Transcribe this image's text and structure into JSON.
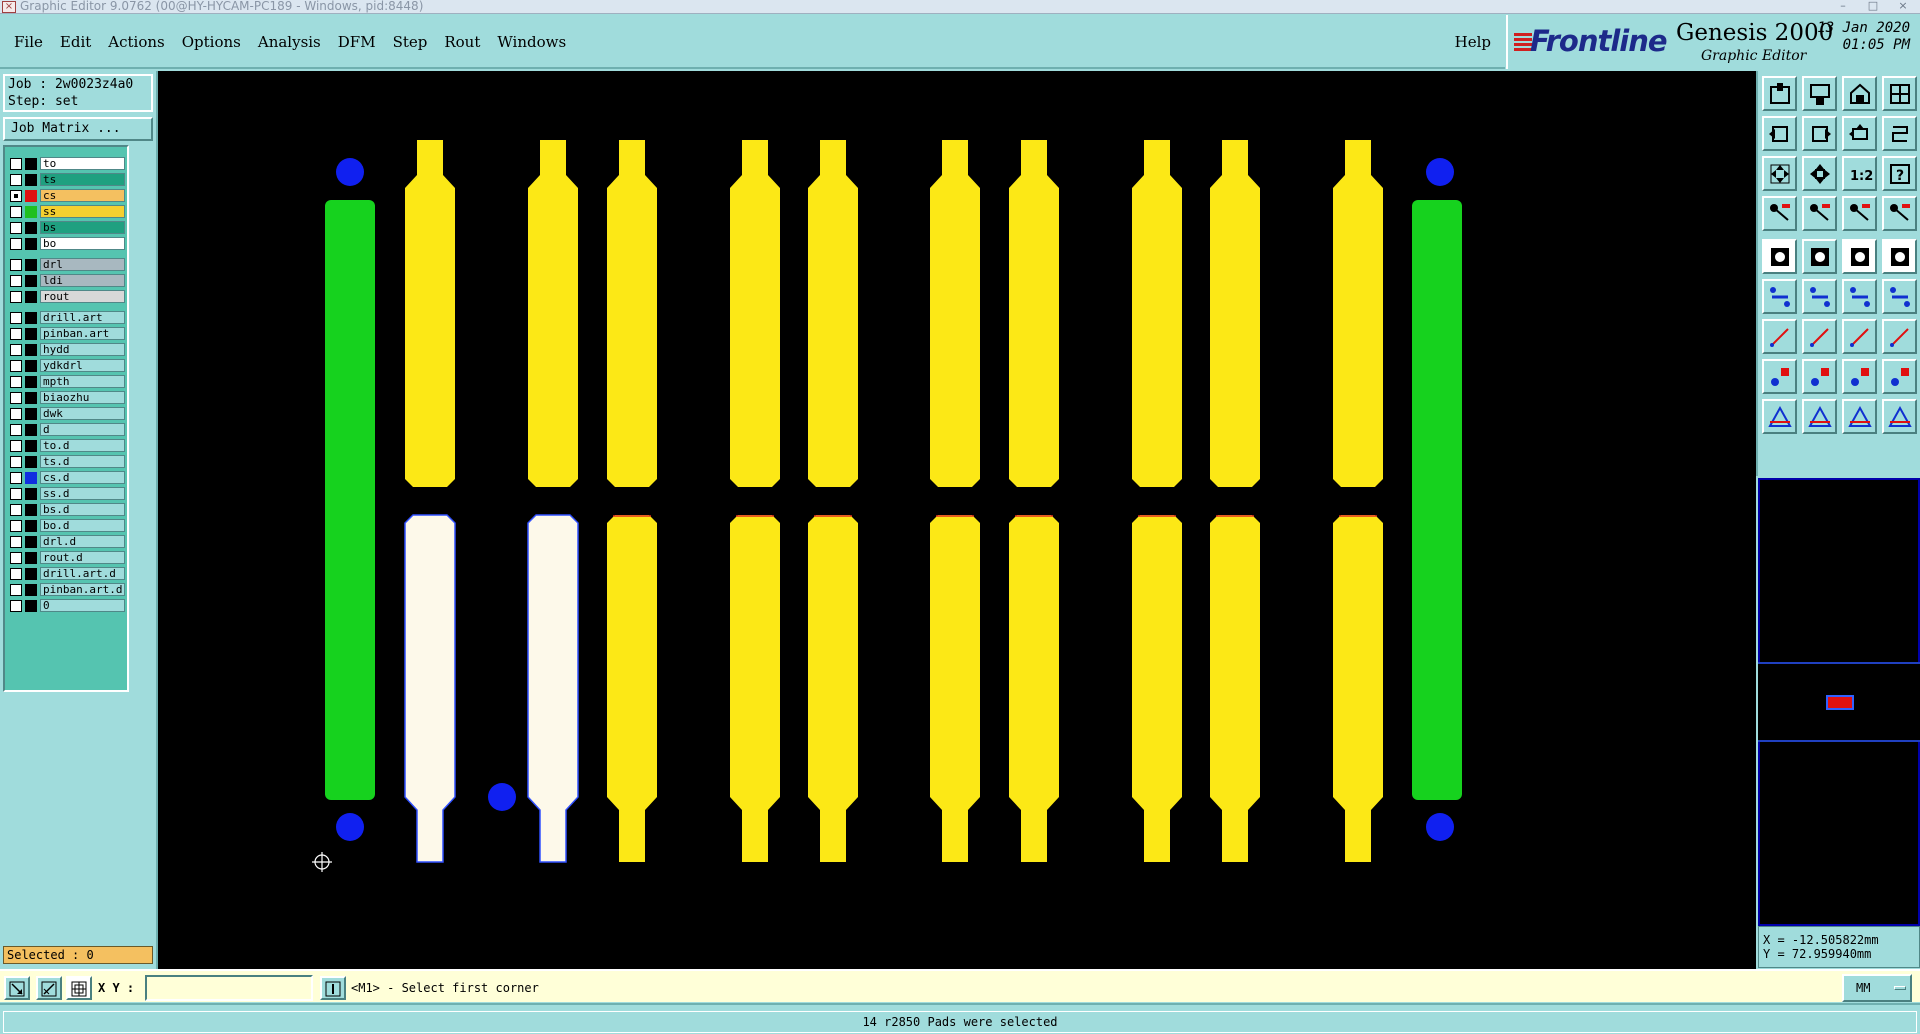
{
  "window": {
    "title": "Graphic Editor 9.0762 (00@HY-HYCAM-PC189 - Windows, pid:8448)",
    "min": "–",
    "max": "□",
    "close": "×"
  },
  "menu": {
    "items": [
      "File",
      "Edit",
      "Actions",
      "Options",
      "Analysis",
      "DFM",
      "Step",
      "Rout",
      "Windows"
    ],
    "help": "Help"
  },
  "brand": {
    "logo": "Frontline",
    "product": "Genesis 2000",
    "subtitle": "Graphic Editor",
    "date": "13 Jan 2020",
    "time": "01:05 PM"
  },
  "job": {
    "job_line": "Job : 2w0023z4a0",
    "step_line": "Step: set",
    "matrix_button": "Job Matrix ..."
  },
  "layers": [
    {
      "name": "to",
      "color": "#ffffff",
      "swatch": "#000000",
      "checked": false
    },
    {
      "name": "ts",
      "color": "#1fa080",
      "swatch": "#000000",
      "checked": false
    },
    {
      "name": "cs",
      "color": "#f4c060",
      "swatch": "#e01010",
      "checked": true
    },
    {
      "name": "ss",
      "color": "#f4d030",
      "swatch": "#20c020",
      "checked": false
    },
    {
      "name": "bs",
      "color": "#1fa080",
      "swatch": "#000000",
      "checked": false
    },
    {
      "name": "bo",
      "color": "#ffffff",
      "swatch": "#000000",
      "checked": false
    },
    {
      "name": "drl",
      "color": "#a8b8c0",
      "swatch": "#000000",
      "checked": false
    },
    {
      "name": "ldi",
      "color": "#a8b8c0",
      "swatch": "#000000",
      "checked": false
    },
    {
      "name": "rout",
      "color": "#d8d8d8",
      "swatch": "#000000",
      "checked": false
    },
    {
      "name": "drill.art",
      "color": "#a0dcdc",
      "swatch": "#000000",
      "checked": false
    },
    {
      "name": "pinban.art",
      "color": "#a0dcdc",
      "swatch": "#000000",
      "checked": false
    },
    {
      "name": "hydd",
      "color": "#a0dcdc",
      "swatch": "#000000",
      "checked": false
    },
    {
      "name": "ydkdrl",
      "color": "#a0dcdc",
      "swatch": "#000000",
      "checked": false
    },
    {
      "name": "mpth",
      "color": "#a0dcdc",
      "swatch": "#000000",
      "checked": false
    },
    {
      "name": "biaozhu",
      "color": "#a0dcdc",
      "swatch": "#000000",
      "checked": false
    },
    {
      "name": "dwk",
      "color": "#a0dcdc",
      "swatch": "#000000",
      "checked": false
    },
    {
      "name": "d",
      "color": "#a0dcdc",
      "swatch": "#000000",
      "checked": false
    },
    {
      "name": "to.d",
      "color": "#a0dcdc",
      "swatch": "#000000",
      "checked": false
    },
    {
      "name": "ts.d",
      "color": "#a0dcdc",
      "swatch": "#000000",
      "checked": false
    },
    {
      "name": "cs.d",
      "color": "#a0dcdc",
      "swatch": "#1030e0",
      "checked": false
    },
    {
      "name": "ss.d",
      "color": "#a0dcdc",
      "swatch": "#000000",
      "checked": false
    },
    {
      "name": "bs.d",
      "color": "#a0dcdc",
      "swatch": "#000000",
      "checked": false
    },
    {
      "name": "bo.d",
      "color": "#a0dcdc",
      "swatch": "#000000",
      "checked": false
    },
    {
      "name": "drl.d",
      "color": "#a0dcdc",
      "swatch": "#000000",
      "checked": false
    },
    {
      "name": "rout.d",
      "color": "#a0dcdc",
      "swatch": "#000000",
      "checked": false
    },
    {
      "name": "drill.art.d",
      "color": "#a0dcdc",
      "swatch": "#000000",
      "checked": false
    },
    {
      "name": "pinban.art.d",
      "color": "#a0dcdc",
      "swatch": "#000000",
      "checked": false
    },
    {
      "name": "0",
      "color": "#a0dcdc",
      "swatch": "#000000",
      "checked": false
    }
  ],
  "selected_label": "Selected : 0",
  "coords": {
    "x": "X = -12.505822mm",
    "y": "Y = 72.959940mm"
  },
  "bottom": {
    "xy_label": "X Y :",
    "xy_value": "",
    "prompt": "<M1> - Select first corner",
    "units": "MM"
  },
  "status": "14 r2850 Pads were selected",
  "colors": {
    "pad_yellow": "#fce816",
    "pad_selected": "#fdf9ea",
    "strip_green": "#16d21e",
    "dot_blue": "#1020f0",
    "canvas": "#000000",
    "panel_teal": "#a0dcdc"
  },
  "icons": {
    "toolbar": [
      "home-icon",
      "zoom-icon",
      "window-icon",
      "pan-icon",
      "undo-icon",
      "redo-icon",
      "fit-icon",
      "ratio-icon",
      "help-icon",
      "snap-icon",
      "measure-icon",
      "step-icon",
      "select-icon",
      "shape-icon",
      "ruler-icon",
      "dot-icon",
      "add-line-icon",
      "add-pad-icon",
      "move-icon",
      "copy-icon",
      "edit-line-icon",
      "cut-icon",
      "arc-icon",
      "mirror-icon",
      "resize-icon",
      "break-icon",
      "center-icon",
      "scale-icon",
      "fillet-icon",
      "angle-icon",
      "chamfer-icon",
      "stretch-icon",
      "pointer-icon",
      "pointer-box-icon",
      "pointer-net-icon",
      "pointer-multi-icon"
    ]
  }
}
